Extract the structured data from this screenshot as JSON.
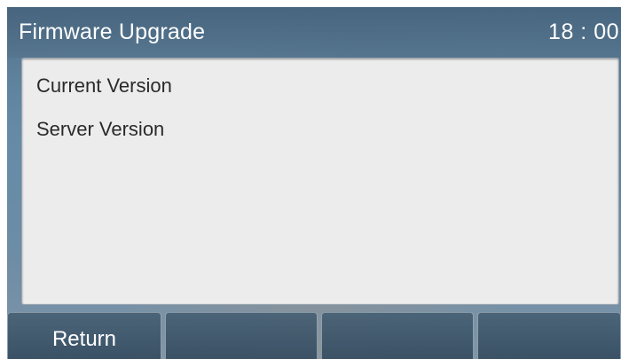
{
  "header": {
    "title": "Firmware Upgrade",
    "clock": "18 : 00"
  },
  "content": {
    "rows": [
      {
        "label": "Current Version"
      },
      {
        "label": "Server Version"
      }
    ]
  },
  "softkeys": [
    {
      "label": "Return"
    },
    {
      "label": ""
    },
    {
      "label": ""
    },
    {
      "label": ""
    }
  ]
}
